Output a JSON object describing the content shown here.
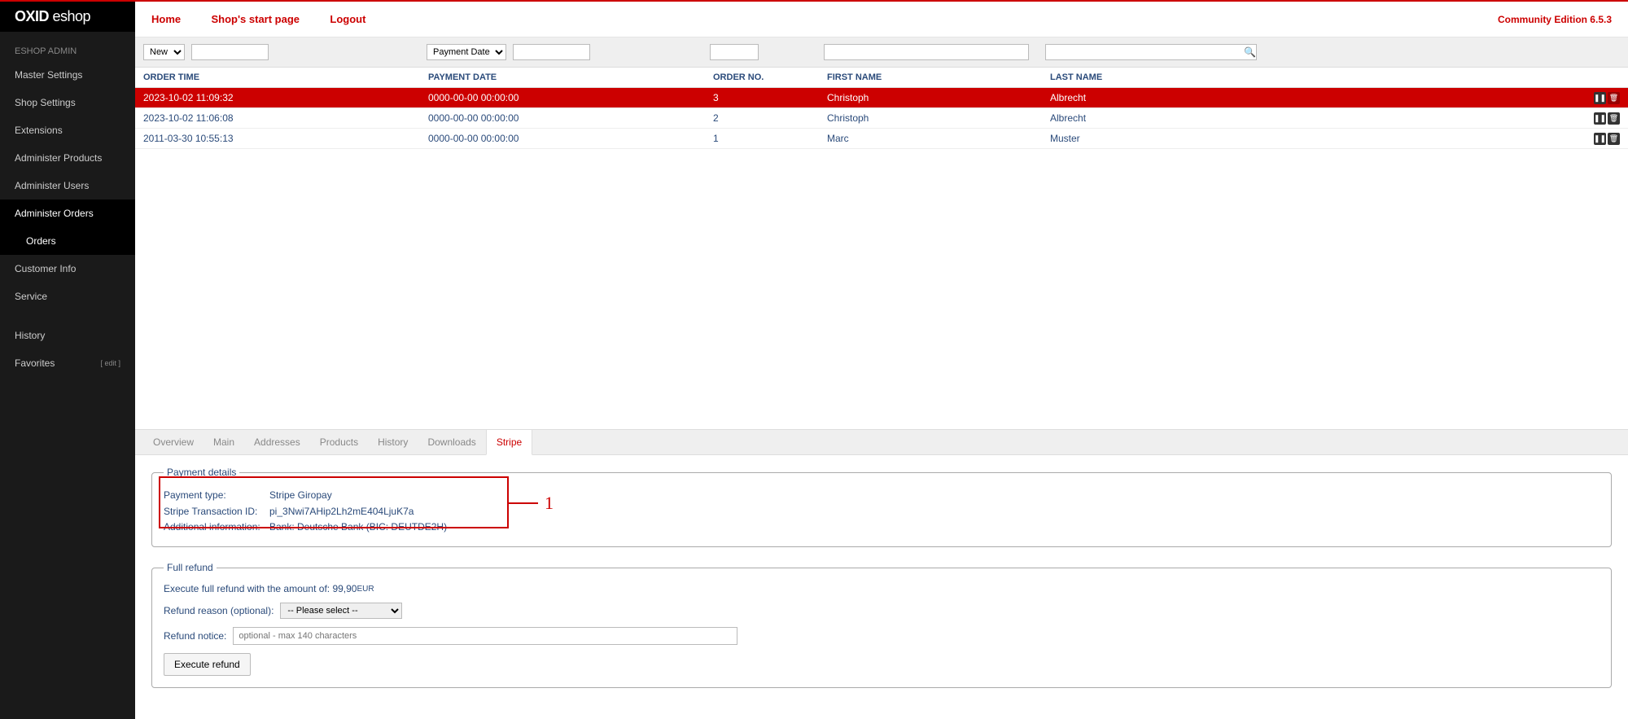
{
  "logo": {
    "bold": "OXID",
    "thin": " eshop"
  },
  "adminLabel": "ESHOP ADMIN",
  "sidebar": {
    "items": [
      "Master Settings",
      "Shop Settings",
      "Extensions",
      "Administer Products",
      "Administer Users",
      "Administer Orders",
      "Customer Info",
      "Service"
    ],
    "sub": "Orders",
    "history": "History",
    "favorites": "Favorites",
    "edit": "[ edit ]"
  },
  "header": {
    "links": [
      "Home",
      "Shop's start page",
      "Logout"
    ],
    "edition": "Community Edition 6.5.3"
  },
  "filters": {
    "statusOptions": [
      "New"
    ],
    "dateOptions": [
      "Payment Date"
    ]
  },
  "columns": {
    "time": "ORDER TIME",
    "pdate": "PAYMENT DATE",
    "ono": "ORDER NO.",
    "fname": "FIRST NAME",
    "lname": "LAST NAME"
  },
  "rows": [
    {
      "time": "2023-10-02 11:09:32",
      "pdate": "0000-00-00 00:00:00",
      "ono": "3",
      "fname": "Christoph",
      "lname": "Albrecht",
      "selected": true
    },
    {
      "time": "2023-10-02 11:06:08",
      "pdate": "0000-00-00 00:00:00",
      "ono": "2",
      "fname": "Christoph",
      "lname": "Albrecht",
      "selected": false
    },
    {
      "time": "2011-03-30 10:55:13",
      "pdate": "0000-00-00 00:00:00",
      "ono": "1",
      "fname": "Marc",
      "lname": "Muster",
      "selected": false
    }
  ],
  "tabs": [
    "Overview",
    "Main",
    "Addresses",
    "Products",
    "History",
    "Downloads",
    "Stripe"
  ],
  "paymentDetails": {
    "legend": "Payment details",
    "rows": [
      {
        "label": "Payment type:",
        "value": "Stripe Giropay"
      },
      {
        "label": "Stripe Transaction ID:",
        "value": "pi_3Nwi7AHip2Lh2mE404LjuK7a"
      },
      {
        "label": "Additional information:",
        "value": "Bank: Deutsche Bank (BIC: DEUTDE2H)"
      }
    ],
    "annotation": "1"
  },
  "refund": {
    "legend": "Full refund",
    "amountText": "Execute full refund with the amount of: 99,90 ",
    "amountCurrency": "EUR",
    "reasonLabel": "Refund reason (optional):",
    "reasonPlaceholder": "-- Please select --",
    "noticeLabel": "Refund notice:",
    "noticePlaceholder": "optional - max 140 characters",
    "button": "Execute refund"
  }
}
